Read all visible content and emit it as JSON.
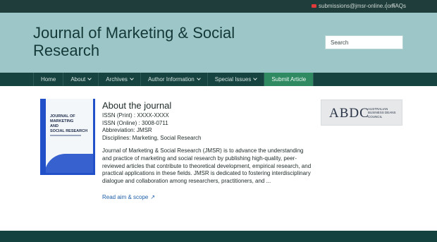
{
  "topbar": {
    "email": "submissions@jmsr-online.com",
    "faq": "FAQs"
  },
  "header": {
    "title_line1": "Journal of Marketing & Social",
    "title_line2": "Research",
    "search_placeholder": "Search"
  },
  "nav": {
    "items": [
      {
        "label": "Home"
      },
      {
        "label": "About"
      },
      {
        "label": "Archives"
      },
      {
        "label": "Author Information"
      },
      {
        "label": "Special Issues"
      },
      {
        "label": "Submit Article"
      }
    ]
  },
  "cover": {
    "title_line1": "JOURNAL OF",
    "title_line2": "MARKETING",
    "title_line3": "AND",
    "title_line4": "SOCIAL RESEARCH"
  },
  "about": {
    "heading": "About the journal",
    "issn_print": "ISSN (Print) : XXXX-XXXX",
    "issn_online": "ISSN (Online) : 3008-0711",
    "abbreviation": "Abbreviation: JMSR",
    "disciplines": "Disciplines: Marketing, Social Research",
    "description": "Journal of Marketing & Social Research (JMSR) is to advance the understanding and practice of marketing and social research by publishing high-quality, peer-reviewed articles that contribute to theoretical development, empirical research, and practical applications in these fields. JMSR is dedicated to fostering interdisciplinary dialogue and collaboration among researchers, practitioners, and ...",
    "read_more": "Read aim & scope"
  },
  "abdc": {
    "logo_text": "ABDC",
    "line1": "AUSTRALIAN",
    "line2": "BUSINESS DEANS",
    "line3": "COUNCIL"
  },
  "colors": {
    "header_bg": "#9dc6c8",
    "nav_bg": "#16423f",
    "submit_bg": "#2f8a61",
    "link": "#1e5fa8"
  }
}
